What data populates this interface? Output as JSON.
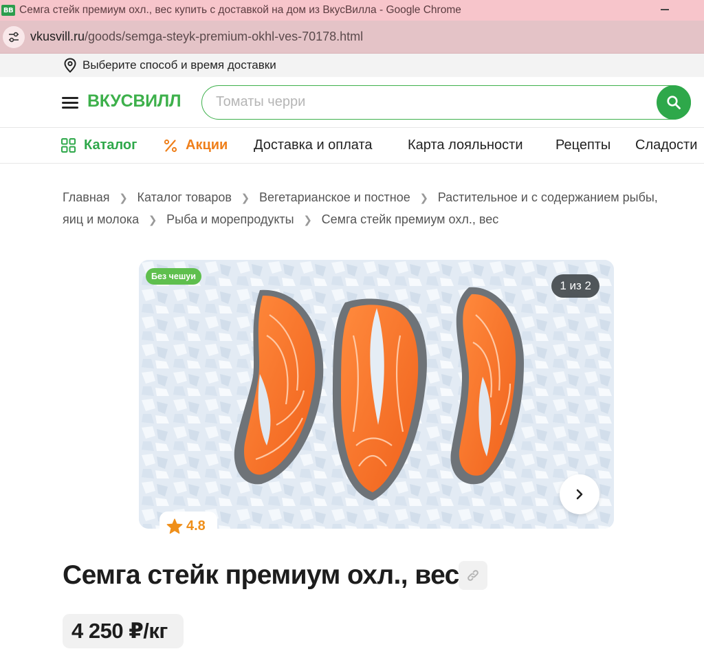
{
  "browser": {
    "favicon_text": "BB",
    "window_title": "Семга стейк премиум охл., вес купить с доставкой на дом из ВкусВилла - Google Chrome",
    "url_host": "vkusvill.ru",
    "url_path": "/goods/semga-steyk-premium-okhl-ves-70178.html"
  },
  "delivery": {
    "label": "Выберите способ и время доставки"
  },
  "header": {
    "logo": "ВКУСВИЛЛ",
    "search_placeholder": "Томаты черри",
    "brand_color": "#3db04b"
  },
  "nav": {
    "items": [
      {
        "label": "Каталог",
        "icon": "grid-icon"
      },
      {
        "label": "Акции",
        "icon": "percent-icon"
      },
      {
        "label": "Доставка и оплата"
      },
      {
        "label": "Карта лояльности"
      },
      {
        "label": "Рецепты"
      },
      {
        "label": "Сладости"
      }
    ]
  },
  "breadcrumbs": [
    "Главная",
    "Каталог товаров",
    "Вегетарианское и постное",
    "Растительное и с содержанием рыбы, яиц и молока",
    "Рыба и морепродукты",
    "Семга стейк премиум охл., вес"
  ],
  "gallery": {
    "tag": "Без чешуи",
    "counter": "1 из 2",
    "rating": "4.8"
  },
  "product": {
    "title": "Семга стейк премиум охл., вес",
    "price": "4 250 ₽/кг"
  }
}
